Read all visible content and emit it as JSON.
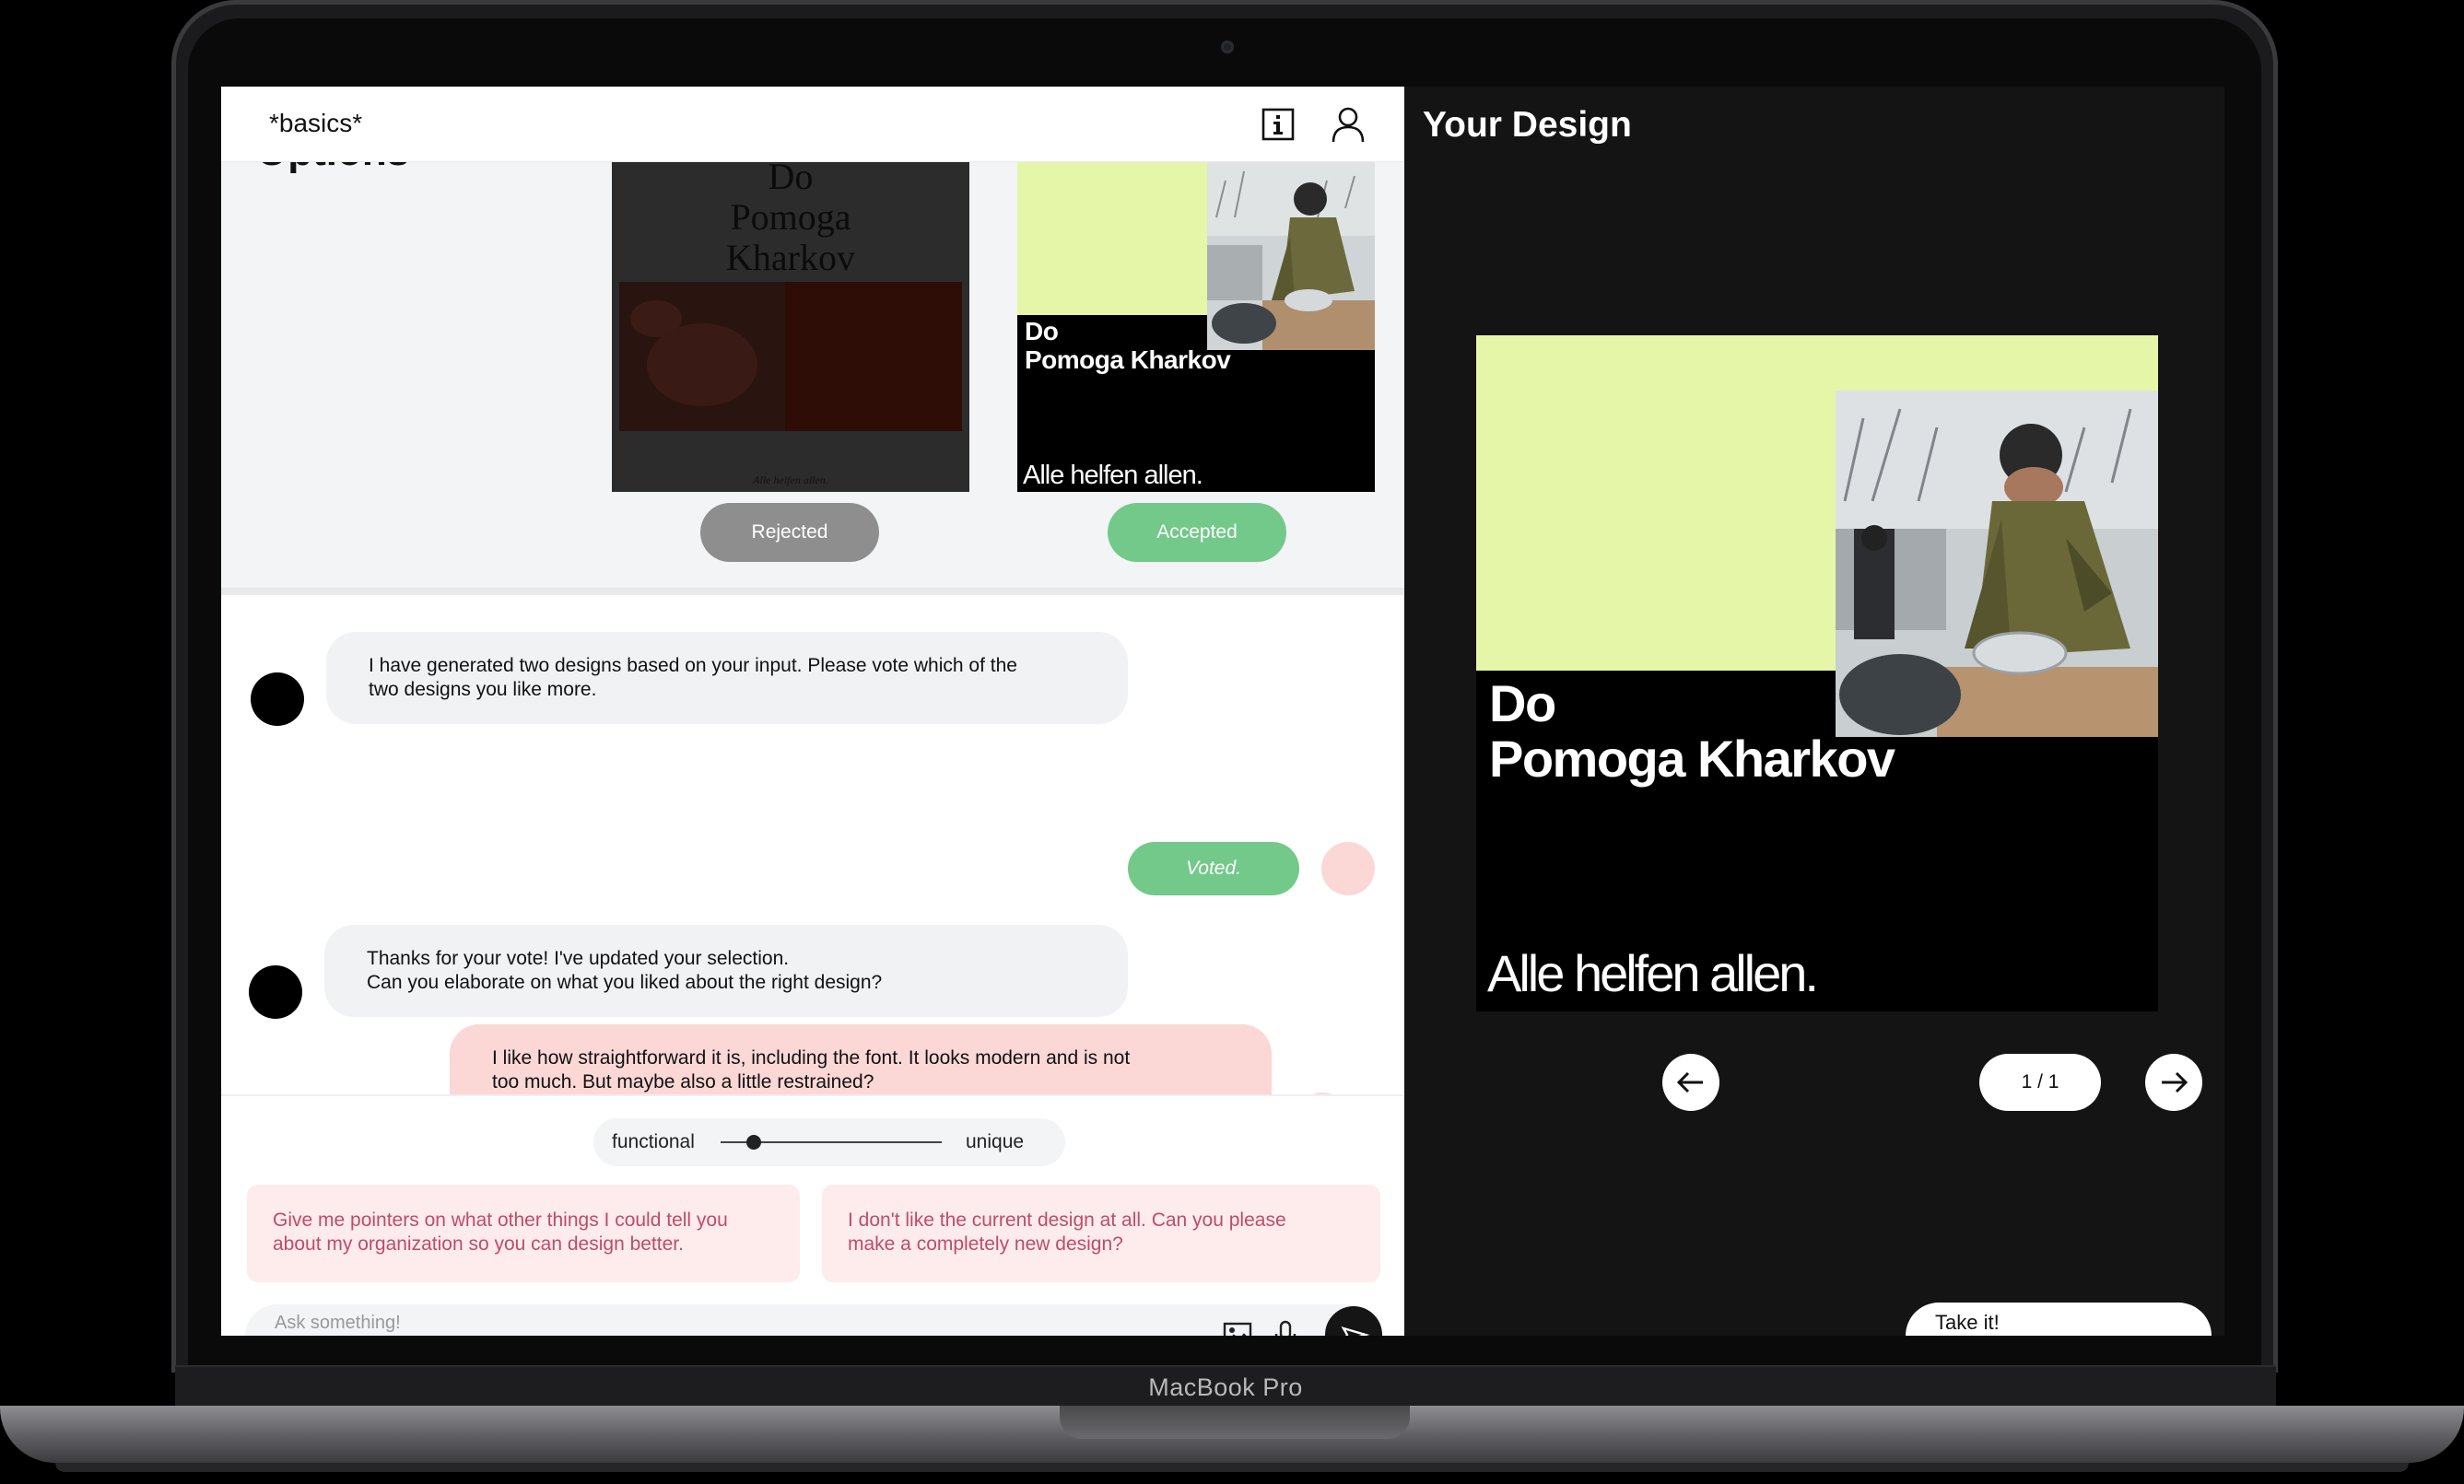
{
  "device": {
    "label": "MacBook Pro"
  },
  "app": {
    "title": "*basics*",
    "info_icon": "info-icon",
    "user_icon": "user-icon"
  },
  "options": {
    "heading": "Options",
    "design_a": {
      "title_line1": "Do",
      "title_line2": "Pomoga",
      "title_line3": "Kharkov",
      "tagline": "Alle helfen allen.",
      "status": "Rejected"
    },
    "design_b": {
      "title_line1": "Do",
      "title_line2": "Pomoga Kharkov",
      "tagline": "Alle helfen allen.",
      "status": "Accepted"
    }
  },
  "chat": {
    "messages": [
      {
        "from": "bot",
        "line1": "I have generated two designs based on your input. Please vote which of the",
        "line2": "two designs you like more."
      },
      {
        "from": "user",
        "text": "Voted."
      },
      {
        "from": "bot",
        "line1": "Thanks for your vote! I've updated your selection.",
        "line2": "Can you elaborate on what you liked about the right design?"
      },
      {
        "from": "user",
        "line1": "I like how straightforward it is, including the font. It looks modern and is not",
        "line2": "too much. But maybe also a little restrained?"
      }
    ]
  },
  "slider": {
    "left_label": "functional",
    "right_label": "unique",
    "value": 0.15
  },
  "suggestions": [
    {
      "line1": "Give me pointers on what other things I could tell you",
      "line2": "about my organization so you can design better."
    },
    {
      "line1": "I don't like the current design at all. Can you please",
      "line2": "make a completely new design?"
    }
  ],
  "ask": {
    "placeholder": "Ask something!",
    "image_icon": "image-icon",
    "mic_icon": "microphone-icon",
    "send_icon": "send-icon"
  },
  "your_design": {
    "heading": "Your Design",
    "title_line1": "Do",
    "title_line2": "Pomoga Kharkov",
    "tagline": "Alle helfen allen.",
    "pager": "1 / 1",
    "prev_icon": "arrow-left-icon",
    "next_icon": "arrow-right-icon",
    "delete_icon": "trash-icon",
    "delete_color": "#e0474c",
    "take_label": "Take it!"
  },
  "colors": {
    "accent_green": "#73c98a",
    "poster_lime": "#e5f6a8",
    "user_pink": "#fbd7d6",
    "suggestion_text": "#c04b6a"
  }
}
